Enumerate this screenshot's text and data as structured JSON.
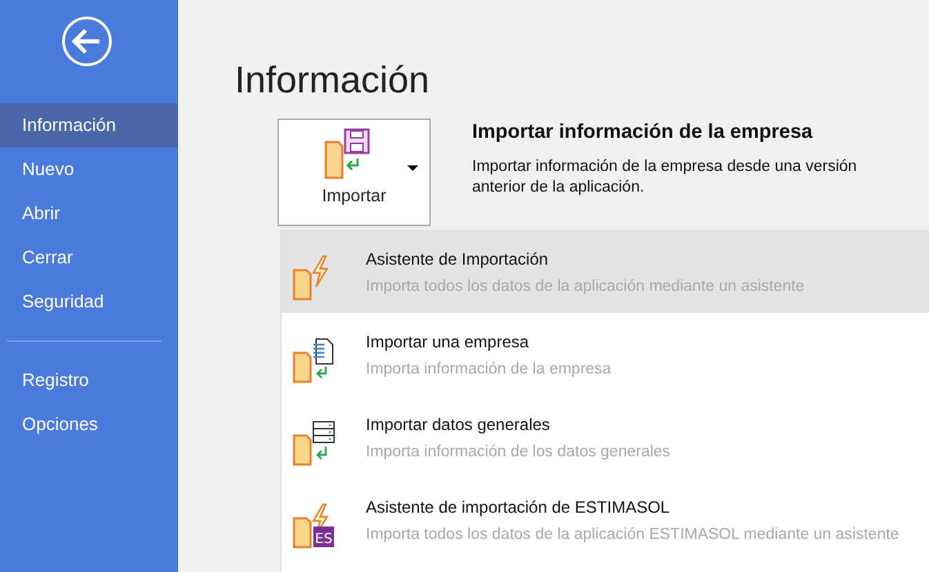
{
  "sidebar": {
    "groups": [
      {
        "items": [
          {
            "label": "Información",
            "selected": true
          },
          {
            "label": "Nuevo",
            "selected": false
          },
          {
            "label": "Abrir",
            "selected": false
          },
          {
            "label": "Cerrar",
            "selected": false
          },
          {
            "label": "Seguridad",
            "selected": false
          }
        ]
      },
      {
        "items": [
          {
            "label": "Registro",
            "selected": false
          },
          {
            "label": "Opciones",
            "selected": false
          }
        ]
      }
    ]
  },
  "page_title": "Información",
  "import_button": {
    "label": "Importar"
  },
  "section": {
    "title": "Importar información de la empresa",
    "description": "Importar información de la empresa desde una versión anterior de la aplicación."
  },
  "menu": [
    {
      "kind": "wizard",
      "title": "Asistente de Importación",
      "subtitle": "Importa todos los datos de la aplicación mediante un asistente",
      "selected": true
    },
    {
      "kind": "document",
      "title": "Importar una empresa",
      "subtitle": "Importa información de la empresa",
      "selected": false
    },
    {
      "kind": "data",
      "title": "Importar datos generales",
      "subtitle": "Importa información de los datos generales",
      "selected": false
    },
    {
      "kind": "estimasol",
      "title": "Asistente de importación de ESTIMASOL",
      "subtitle": "Importa todos los datos de la aplicación ESTIMASOL mediante un asistente",
      "badge": "ES",
      "selected": false
    }
  ]
}
